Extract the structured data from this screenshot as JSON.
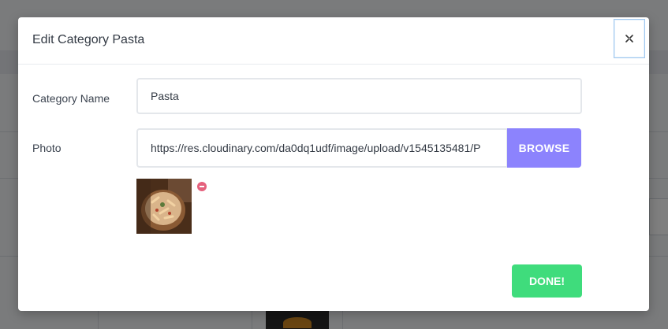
{
  "modal": {
    "title": "Edit Category Pasta",
    "close_icon": "close-icon"
  },
  "form": {
    "category_name_label": "Category Name",
    "category_name_value": "Pasta",
    "photo_label": "Photo",
    "photo_url_value": "https://res.cloudinary.com/da0dq1udf/image/upload/v1545135481/P",
    "browse_label": "BROWSE",
    "thumbnail_alt": "Pasta",
    "remove_icon": "minus-circle-icon"
  },
  "footer": {
    "done_label": "DONE!"
  },
  "colors": {
    "browse": "#8c83fd",
    "done": "#3fdc7c",
    "remove": "#e5617d"
  }
}
